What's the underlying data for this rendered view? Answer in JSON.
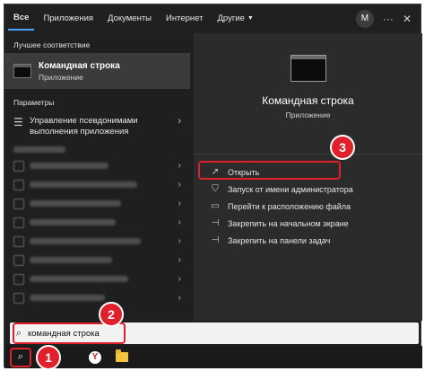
{
  "tabs": [
    {
      "label": "Все",
      "active": true
    },
    {
      "label": "Приложения"
    },
    {
      "label": "Документы"
    },
    {
      "label": "Интернет"
    },
    {
      "label": "Другие"
    }
  ],
  "avatar_letter": "M",
  "best_match": {
    "section_label": "Лучшее соответствие",
    "title": "Командная строка",
    "subtitle": "Приложение"
  },
  "settings": {
    "section_label": "Параметры",
    "item_label": "Управление псевдонимами выполнения приложения"
  },
  "preview": {
    "title": "Командная строка",
    "subtitle": "Приложение"
  },
  "actions": [
    {
      "label": "Открыть",
      "icon": "open-icon"
    },
    {
      "label": "Запуск от имени администратора",
      "icon": "admin-icon"
    },
    {
      "label": "Перейти к расположению файла",
      "icon": "folder-icon"
    },
    {
      "label": "Закрепить на начальном экране",
      "icon": "pin-icon"
    },
    {
      "label": "Закрепить на панели задач",
      "icon": "pin-icon"
    }
  ],
  "search": {
    "value": "командная строка"
  },
  "markers": [
    "1",
    "2",
    "3"
  ],
  "colors": {
    "accent": "#4aa3ff",
    "highlight": "#e0202a"
  }
}
